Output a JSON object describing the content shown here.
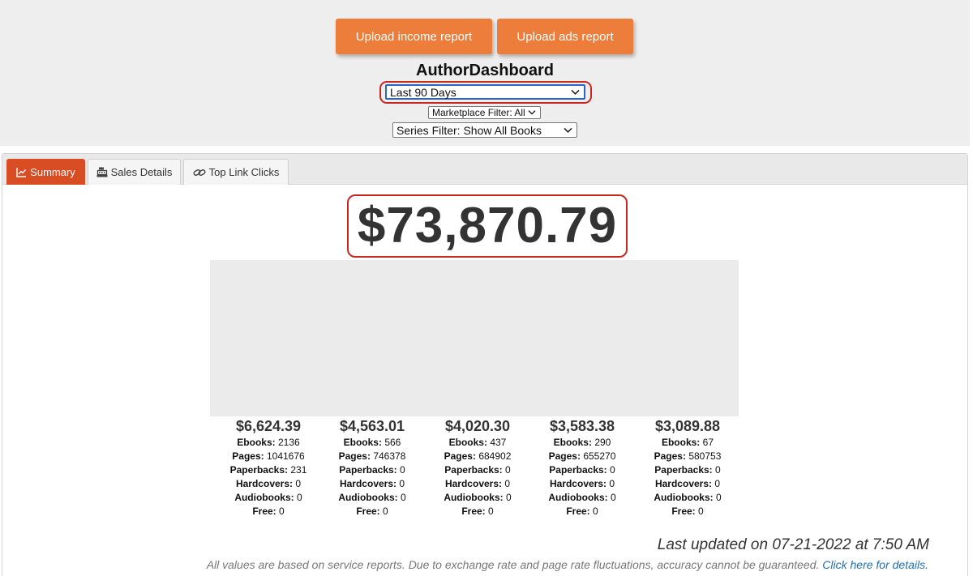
{
  "upload_buttons": {
    "income": "Upload income report",
    "ads": "Upload ads report"
  },
  "app": {
    "title": "AuthorDashboard"
  },
  "filters": {
    "period": "Last 90 Days",
    "marketplace": "Marketplace Filter: All",
    "series": "Series Filter: Show All Books"
  },
  "tabs": [
    {
      "label": "Summary",
      "icon": "chart-line-icon",
      "active": true
    },
    {
      "label": "Sales Details",
      "icon": "cash-register-icon",
      "active": false
    },
    {
      "label": "Top Link Clicks",
      "icon": "link-icon",
      "active": false
    }
  ],
  "summary": {
    "total": "$73,870.79"
  },
  "labels": {
    "ebooks": "Ebooks:",
    "pages": "Pages:",
    "paperbacks": "Paperbacks:",
    "hardcovers": "Hardcovers:",
    "audiobooks": "Audiobooks:",
    "free": "Free:"
  },
  "breakdown": [
    {
      "amount": "$6,624.39",
      "ebooks": "2136",
      "pages": "1041676",
      "paperbacks": "231",
      "hardcovers": "0",
      "audiobooks": "0",
      "free": "0"
    },
    {
      "amount": "$4,563.01",
      "ebooks": "566",
      "pages": "746378",
      "paperbacks": "0",
      "hardcovers": "0",
      "audiobooks": "0",
      "free": "0"
    },
    {
      "amount": "$4,020.30",
      "ebooks": "437",
      "pages": "684902",
      "paperbacks": "0",
      "hardcovers": "0",
      "audiobooks": "0",
      "free": "0"
    },
    {
      "amount": "$3,583.38",
      "ebooks": "290",
      "pages": "655270",
      "paperbacks": "0",
      "hardcovers": "0",
      "audiobooks": "0",
      "free": "0"
    },
    {
      "amount": "$3,089.88",
      "ebooks": "67",
      "pages": "580753",
      "paperbacks": "0",
      "hardcovers": "0",
      "audiobooks": "0",
      "free": "0"
    }
  ],
  "footer": {
    "updated": "Last updated on 07-21-2022 at 7:50 AM",
    "disclaimer": "All values are based on service reports. Due to exchange rate and page rate fluctuations, accuracy cannot be guaranteed.",
    "details_link": "Click here for details."
  },
  "colors": {
    "accent": "#ec7d3a",
    "active_tab": "#d84d24",
    "highlight": "#c8281e",
    "link": "#1f6fb5"
  }
}
